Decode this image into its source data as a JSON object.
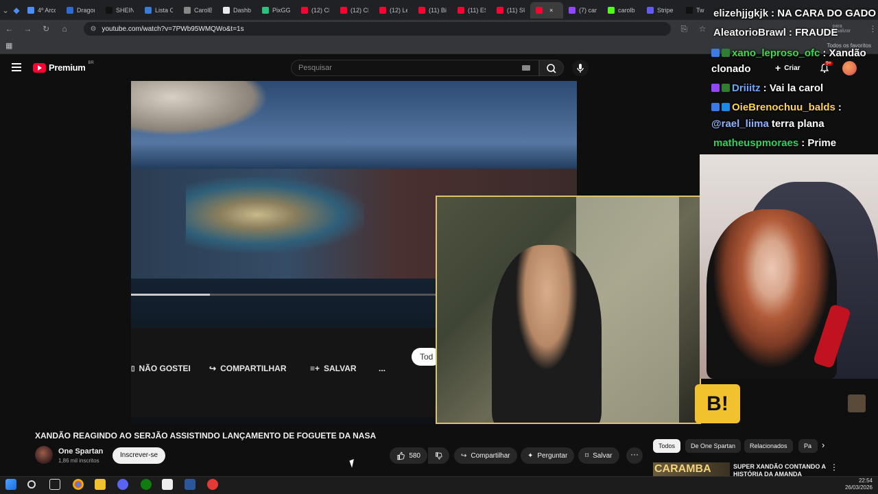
{
  "browser": {
    "tabs": [
      {
        "label": "4º Arco",
        "color": "#4f8df7"
      },
      {
        "label": "Dragon",
        "color": "#2e6ad1"
      },
      {
        "label": "SHEIN",
        "color": "#111111"
      },
      {
        "label": "Lista C",
        "color": "#3a7bd5"
      },
      {
        "label": "CarolB",
        "color": "#888888"
      },
      {
        "label": "Dashb",
        "color": "#e8eaed"
      },
      {
        "label": "PixGG",
        "color": "#2ec27e"
      },
      {
        "label": "(12) Cl",
        "color": "#ff0033"
      },
      {
        "label": "(12) Cl",
        "color": "#ff0033"
      },
      {
        "label": "(12) Le",
        "color": "#ff0033"
      },
      {
        "label": "(11) Bi",
        "color": "#ff0033"
      },
      {
        "label": "(11) ES",
        "color": "#ff0033"
      },
      {
        "label": "(11) SU",
        "color": "#ff0033"
      },
      {
        "label": "",
        "color": "#ff0033",
        "active": true
      },
      {
        "label": "(7) car",
        "color": "#9146ff"
      },
      {
        "label": "carolb",
        "color": "#53fc18"
      },
      {
        "label": "Stripe",
        "color": "#635bff"
      },
      {
        "label": "Tw",
        "color": "#111111"
      }
    ],
    "url": "youtube.com/watch?v=7PWb95WMQWo&t=1s",
    "update_hint": "para atualizar",
    "bookmarks_folder": "Todos os favoritos"
  },
  "youtube": {
    "logo_text": "Premium",
    "region": "BR",
    "search_placeholder": "Pesquisar",
    "create_label": "Criar",
    "notifications_badge": "9+"
  },
  "player_overlay": {
    "actions": [
      "NÃO GOSTEI",
      "COMPARTILHAR",
      "SALVAR",
      "..."
    ],
    "chip_partial": "Tod"
  },
  "chat": [
    {
      "user": "elizehjjgkjk",
      "user_color": "#ffffff",
      "message": ": NA CARA DO GADO"
    },
    {
      "user": "AleatorioBrawl",
      "user_color": "#ffffff",
      "message": ": FRAUDE"
    },
    {
      "user": "xano_leproso_ofc",
      "user_color": "#3ddc4f",
      "message": ": Xandão"
    },
    {
      "user": "",
      "user_color": "#ffffff",
      "message": "clonado"
    },
    {
      "user": "Driiitz",
      "user_color": "#6aa8ff",
      "message": ": Vai la carol"
    },
    {
      "user": "OieBrenochuu_balds",
      "user_color": "#ffd54a",
      "message": ":"
    },
    {
      "user": "@rael_liima",
      "user_color": "#8fb4ff",
      "message": "terra plana"
    },
    {
      "user": "matheuspmoraes",
      "user_color": "#2fd35c",
      "message": ": Prime"
    }
  ],
  "video": {
    "title": "XANDÃO REAGINDO AO SERJÃO ASSISTINDO LANÇAMENTO DE FOGUETE DA NASA",
    "channel": "One Spartan",
    "subscribers": "1,86 mil inscritos",
    "subscribe_label": "Inscrever-se",
    "likes": "580",
    "share_label": "Compartilhar",
    "ask_label": "Perguntar",
    "save_label": "Salvar"
  },
  "chips": [
    "Todos",
    "De One Spartan",
    "Relacionados",
    "Pa"
  ],
  "recommendation": {
    "thumb_text": "CARAMBA",
    "title": "SUPER XANDÃO CONTANDO A HISTÓRIA DA AMANDA"
  },
  "taskbar": {
    "time": "22:54",
    "date": "26/03/2026"
  }
}
